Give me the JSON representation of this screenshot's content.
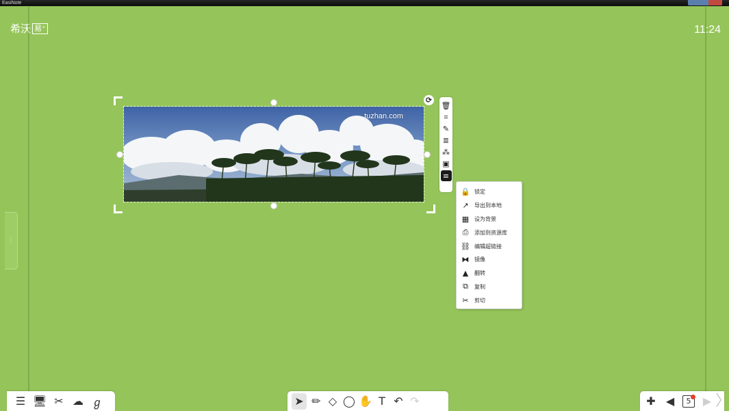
{
  "window": {
    "title": "EasiNote"
  },
  "brand": {
    "logo_text": "希沃",
    "logo_box_text": "易⁺"
  },
  "clock": {
    "time": "11:24"
  },
  "image": {
    "watermark": "tuzhan.com"
  },
  "object_toolbar": {
    "items": [
      {
        "name": "delete-icon",
        "glyph": "🗑"
      },
      {
        "name": "crop-icon",
        "glyph": "⌗"
      },
      {
        "name": "edit-image-icon",
        "glyph": "✎"
      },
      {
        "name": "align-icon",
        "glyph": "≣"
      },
      {
        "name": "effects-icon",
        "glyph": "⁂"
      },
      {
        "name": "layer-icon",
        "glyph": "▣"
      },
      {
        "name": "more-menu-icon",
        "glyph": "≡",
        "active": true
      }
    ]
  },
  "context_menu": {
    "items": [
      {
        "icon": "lock-icon",
        "glyph": "🔒",
        "label": "锁定"
      },
      {
        "icon": "export-icon",
        "glyph": "↗",
        "label": "导出到本地"
      },
      {
        "icon": "set-background-icon",
        "glyph": "▦",
        "label": "设为背景"
      },
      {
        "icon": "add-to-library-icon",
        "glyph": "⎙",
        "label": "添加到资源库"
      },
      {
        "icon": "edit-link-icon",
        "glyph": "⛓",
        "label": "编辑超链接"
      },
      {
        "icon": "mirror-icon",
        "glyph": "⧓",
        "label": "镜像"
      },
      {
        "icon": "flip-icon",
        "glyph": "▲",
        "label": "翻转"
      },
      {
        "icon": "copy-icon",
        "glyph": "⧉",
        "label": "复制"
      },
      {
        "icon": "cut-icon",
        "glyph": "✂",
        "label": "剪切"
      }
    ]
  },
  "bottom_left_toolbar": {
    "items": [
      {
        "name": "menu-icon",
        "glyph": "☰"
      },
      {
        "name": "screen-icon",
        "glyph": "🖥"
      },
      {
        "name": "tools-icon",
        "glyph": "✂"
      },
      {
        "name": "cloud-icon",
        "glyph": "☁"
      },
      {
        "name": "handwriting-icon",
        "glyph": "ℊ"
      }
    ]
  },
  "bottom_center_toolbar": {
    "items": [
      {
        "name": "select-icon",
        "glyph": "➤",
        "selected": true
      },
      {
        "name": "pen-icon",
        "glyph": "✏"
      },
      {
        "name": "eraser-icon",
        "glyph": "◇"
      },
      {
        "name": "shape-icon",
        "glyph": "◯"
      },
      {
        "name": "roam-hand-icon",
        "glyph": "✋"
      },
      {
        "name": "text-icon",
        "glyph": "T"
      },
      {
        "name": "undo-icon",
        "glyph": "↶"
      },
      {
        "name": "redo-icon",
        "glyph": "↷",
        "disabled": true
      }
    ]
  },
  "bottom_right_toolbar": {
    "items": [
      {
        "name": "add-page-icon",
        "glyph": "✚"
      },
      {
        "name": "prev-page-icon",
        "glyph": "◀"
      },
      {
        "name": "page-list-icon",
        "glyph": "5"
      },
      {
        "name": "next-page-icon",
        "glyph": "▶",
        "disabled": true
      }
    ]
  },
  "colors": {
    "canvas": "#95c55a",
    "toolbar": "#ffffff",
    "menu_border": "#d4d4d4"
  }
}
